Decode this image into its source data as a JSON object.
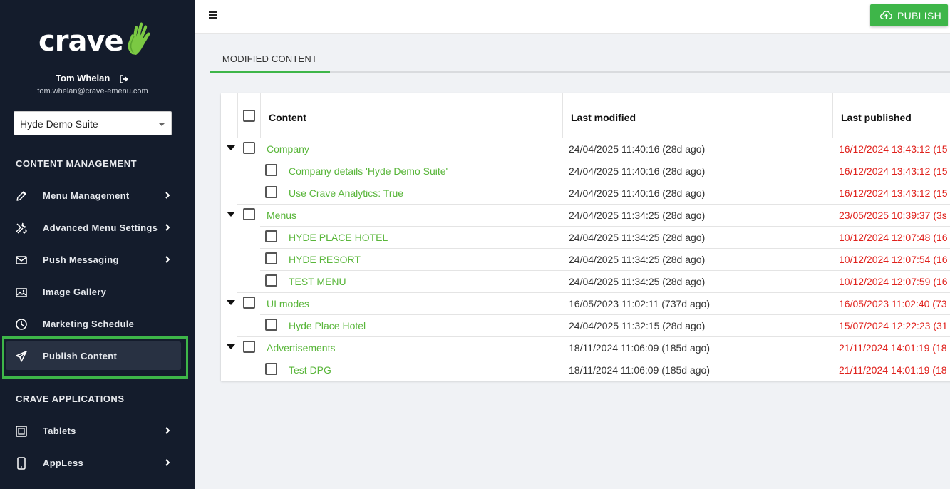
{
  "sidebar": {
    "logo_text": "crave",
    "user_name": "Tom Whelan",
    "user_email": "tom.whelan@crave-emenu.com",
    "suite_selected": "Hyde Demo Suite",
    "sections": {
      "content_management": "CONTENT MANAGEMENT",
      "crave_applications": "CRAVE APPLICATIONS"
    },
    "items": [
      {
        "label": "Menu Management",
        "icon": "pencil-icon",
        "has_chevron": true
      },
      {
        "label": "Advanced Menu Settings",
        "icon": "tools-icon",
        "has_chevron": true
      },
      {
        "label": "Push Messaging",
        "icon": "envelope-icon",
        "has_chevron": true
      },
      {
        "label": "Image Gallery",
        "icon": "image-icon",
        "has_chevron": false
      },
      {
        "label": "Marketing Schedule",
        "icon": "clock-icon",
        "has_chevron": false
      },
      {
        "label": "Publish Content",
        "icon": "paper-plane-icon",
        "has_chevron": false,
        "active": true
      },
      {
        "label": "Tablets",
        "icon": "tablet-icon",
        "has_chevron": true
      },
      {
        "label": "AppLess",
        "icon": "phone-icon",
        "has_chevron": true
      }
    ]
  },
  "header": {
    "publish_label": "PUBLISH"
  },
  "tabs": [
    {
      "label": "MODIFIED CONTENT",
      "active": true
    }
  ],
  "table": {
    "columns": {
      "content": "Content",
      "last_modified": "Last modified",
      "last_published": "Last published"
    },
    "rows": [
      {
        "name": "Company",
        "level": 0,
        "last_modified": "24/04/2025 11:40:16 (28d ago)",
        "last_published": "16/12/2024 13:43:12 (15"
      },
      {
        "name": "Company details 'Hyde Demo Suite'",
        "level": 1,
        "last_modified": "24/04/2025 11:40:16 (28d ago)",
        "last_published": "16/12/2024 13:43:12 (15"
      },
      {
        "name": "Use Crave Analytics: True",
        "level": 1,
        "last_modified": "24/04/2025 11:40:16 (28d ago)",
        "last_published": "16/12/2024 13:43:12 (15"
      },
      {
        "name": "Menus",
        "level": 0,
        "last_modified": "24/04/2025 11:34:25 (28d ago)",
        "last_published": "23/05/2025 10:39:37 (3s"
      },
      {
        "name": "HYDE PLACE HOTEL",
        "level": 1,
        "last_modified": "24/04/2025 11:34:25 (28d ago)",
        "last_published": "10/12/2024 12:07:48 (16"
      },
      {
        "name": "HYDE RESORT",
        "level": 1,
        "last_modified": "24/04/2025 11:34:25 (28d ago)",
        "last_published": "10/12/2024 12:07:54 (16"
      },
      {
        "name": "TEST MENU",
        "level": 1,
        "last_modified": "24/04/2025 11:34:25 (28d ago)",
        "last_published": "10/12/2024 12:07:59 (16"
      },
      {
        "name": "UI modes",
        "level": 0,
        "last_modified": "16/05/2023 11:02:11 (737d ago)",
        "last_published": "16/05/2023 11:02:40 (73"
      },
      {
        "name": "Hyde Place Hotel",
        "level": 1,
        "last_modified": "24/04/2025 11:32:15 (28d ago)",
        "last_published": "15/07/2024 12:22:23 (31"
      },
      {
        "name": "Advertisements",
        "level": 0,
        "last_modified": "18/11/2024 11:06:09 (185d ago)",
        "last_published": "21/11/2024 14:01:19 (18"
      },
      {
        "name": "Test DPG",
        "level": 1,
        "last_modified": "18/11/2024 11:06:09 (185d ago)",
        "last_published": "21/11/2024 14:01:19 (18"
      }
    ]
  },
  "colors": {
    "sidebar_bg": "#141c2c",
    "accent_green": "#3eb649",
    "link_green": "#59b63a",
    "published_red": "#e0211c"
  }
}
